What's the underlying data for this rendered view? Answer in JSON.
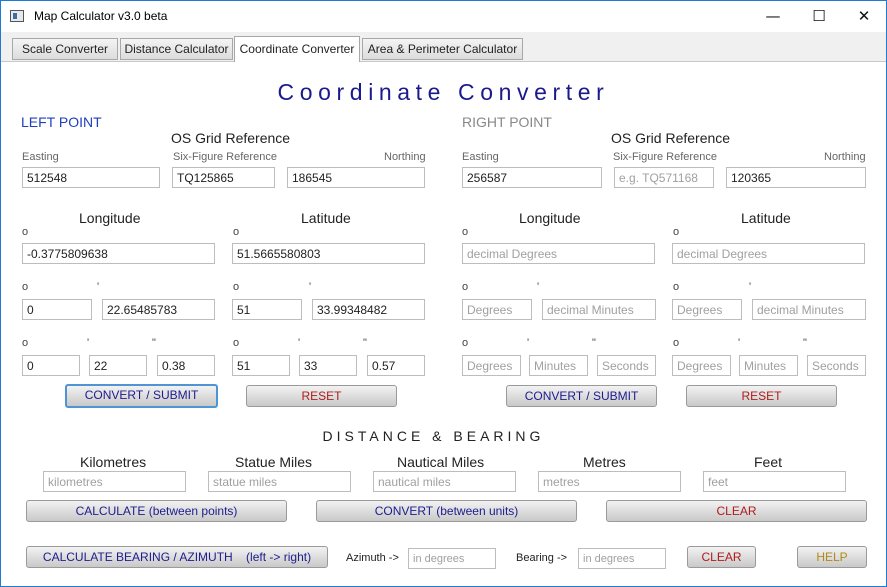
{
  "window": {
    "title": "Map Calculator v3.0 beta",
    "minimize": "—",
    "maximize": "☐",
    "close": "✕"
  },
  "tabs": [
    "Scale Converter",
    "Distance Calculator",
    "Coordinate Converter",
    "Area & Perimeter  Calculator"
  ],
  "main_title": "Coordinate Converter",
  "left": {
    "heading": "LEFT POINT",
    "os_grid_title": "OS Grid Reference",
    "easting_label": "Easting",
    "six_figure_label": "Six-Figure Reference",
    "northing_label": "Northing",
    "easting": "512548",
    "six_figure": "TQ125865",
    "northing": "186545",
    "longitude_title": "Longitude",
    "latitude_title": "Latitude",
    "lon_decimal": "-0.3775809638",
    "lat_decimal": "51.5665580803",
    "lon_deg": "0",
    "lon_dec_min": "22.65485783",
    "lat_deg": "51",
    "lat_dec_min": "33.99348482",
    "lon_d": "0",
    "lon_m": "22",
    "lon_s": "0.38",
    "lat_d": "51",
    "lat_m": "33",
    "lat_s": "0.57",
    "convert_btn": "CONVERT / SUBMIT",
    "reset_btn": "RESET"
  },
  "right": {
    "heading": "RIGHT POINT",
    "os_grid_title": "OS Grid Reference",
    "easting_label": "Easting",
    "six_figure_label": "Six-Figure Reference",
    "northing_label": "Northing",
    "easting": "256587",
    "six_figure_placeholder": "e.g. TQ571168",
    "northing": "120365",
    "longitude_title": "Longitude",
    "latitude_title": "Latitude",
    "decimal_placeholder": "decimal Degrees",
    "degrees_placeholder": "Degrees",
    "dec_min_placeholder": "decimal Minutes",
    "minutes_placeholder": "Minutes",
    "seconds_placeholder": "Seconds",
    "convert_btn": "CONVERT / SUBMIT",
    "reset_btn": "RESET"
  },
  "symbols": {
    "degree": "o",
    "minute": "'",
    "second": "\""
  },
  "distance": {
    "title": "DISTANCE & BEARING",
    "units": [
      {
        "label": "Kilometres",
        "placeholder": "kilometres"
      },
      {
        "label": "Statue Miles",
        "placeholder": "statue miles"
      },
      {
        "label": "Nautical Miles",
        "placeholder": "nautical miles"
      },
      {
        "label": "Metres",
        "placeholder": "metres"
      },
      {
        "label": "Feet",
        "placeholder": "feet"
      }
    ],
    "calculate_btn": "CALCULATE (between points)",
    "convert_btn": "CONVERT (between units)",
    "clear_btn": "CLEAR"
  },
  "bearing": {
    "calculate_btn": "CALCULATE BEARING / AZIMUTH    (left -> right)",
    "azimuth_label": "Azimuth ->",
    "azimuth_placeholder": "in degrees",
    "bearing_label": "Bearing ->",
    "bearing_placeholder": "in degrees",
    "clear_btn": "CLEAR",
    "help_btn": "HELP"
  },
  "colors": {
    "accent_blue": "#1a1a8c",
    "left_heading": "#1f3fbf",
    "right_heading": "#888888",
    "reset_red": "#b01c1c",
    "help_gold": "#b08a17",
    "focus": "#4f95d6"
  }
}
